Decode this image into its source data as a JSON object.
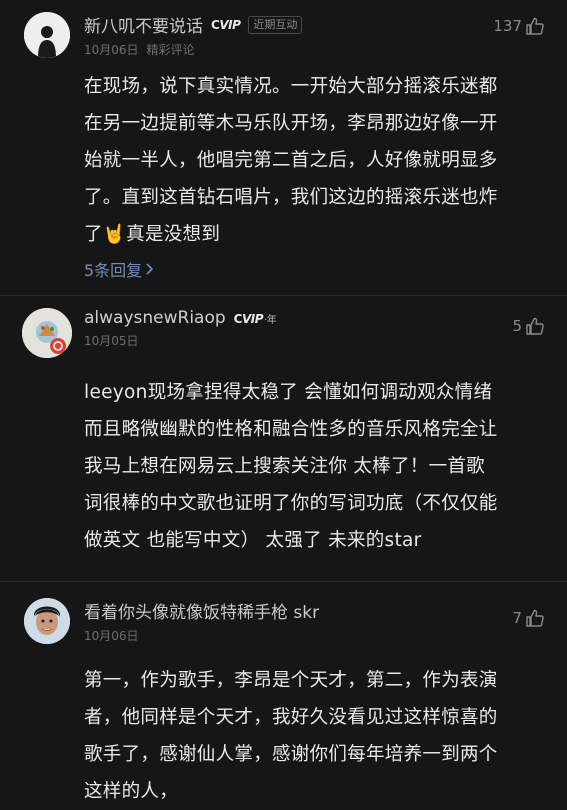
{
  "comments": [
    {
      "user": "新八叽不要说话",
      "vip": "VIP",
      "tag": "近期互动",
      "date": "10月06日",
      "subtitle": "精彩评论",
      "likes": "137",
      "lines": [
        "在现场，说下真实情况。一开始大部分摇滚乐迷都",
        "在另一边提前等木马乐队开场，李昂那边好像一开",
        "始就一半人，他唱完第二首之后，人好像就明显多",
        "了。直到这首钻石唱片，我们这边的摇滚乐迷也炸"
      ],
      "line5_a": "了",
      "line5_emoji": "🤘",
      "line5_b": "真是没想到",
      "replies": "5条回复"
    },
    {
      "user": "alwaysnewRiaop",
      "vip": "VIP",
      "vip_suffix": "年",
      "date": "10月05日",
      "likes": "5",
      "lines": [
        "leeyon现场拿捏得太稳了 会懂如何调动观众情绪",
        "而且略微幽默的性格和融合性多的音乐风格完全让",
        "我马上想在网易云上搜索关注你 太棒了！一首歌",
        "词很棒的中文歌也证明了你的写词功底（不仅仅能",
        "做英文 也能写中文） 太强了 未来的star"
      ]
    },
    {
      "user": "看着你头像就像饭特稀手枪 skr",
      "date": "10月06日",
      "likes": "7",
      "lines": [
        "第一，作为歌手，李昂是个天才，第二，作为表演",
        "者，他同样是个天才，我好久没看见过这样惊喜的",
        "歌手了，感谢仙人掌，感谢你们每年培养一到两个",
        "这样的人，"
      ]
    }
  ]
}
